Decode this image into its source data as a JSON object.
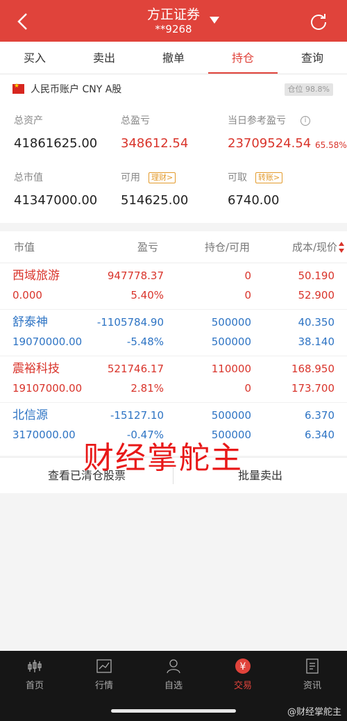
{
  "header": {
    "title": "方正证券",
    "subtitle": "**9268"
  },
  "tabs": [
    {
      "label": "买入"
    },
    {
      "label": "卖出"
    },
    {
      "label": "撤单"
    },
    {
      "label": "持仓",
      "active": true
    },
    {
      "label": "查询"
    }
  ],
  "account": {
    "label": "人民币账户 CNY A股",
    "position_ratio": "仓位 98.8%",
    "stats": {
      "total_assets_label": "总资产",
      "total_assets": "41861625.00",
      "total_pl_label": "总盈亏",
      "total_pl": "348612.54",
      "today_pl_label": "当日参考盈亏",
      "today_pl": "23709524.54",
      "today_pl_pct": "65.58%",
      "market_value_label": "总市值",
      "market_value": "41347000.00",
      "available_label": "可用",
      "available": "514625.00",
      "available_tag": "理财>",
      "withdrawable_label": "可取",
      "withdrawable": "6740.00",
      "withdrawable_tag": "转账>"
    }
  },
  "holdings": {
    "headers": {
      "market_value": "市值",
      "pl": "盈亏",
      "hold": "持仓/可用",
      "cost": "成本/现价"
    },
    "rows": [
      {
        "name": "西域旅游",
        "market_value": "0.000",
        "pl": "947778.37",
        "pl_pct": "5.40%",
        "hold": "0",
        "avail": "0",
        "cost": "50.190",
        "price": "52.900",
        "trend": "up"
      },
      {
        "name": "舒泰神",
        "market_value": "19070000.00",
        "pl": "-1105784.90",
        "pl_pct": "-5.48%",
        "hold": "500000",
        "avail": "500000",
        "cost": "40.350",
        "price": "38.140",
        "trend": "down"
      },
      {
        "name": "震裕科技",
        "market_value": "19107000.00",
        "pl": "521746.17",
        "pl_pct": "2.81%",
        "hold": "110000",
        "avail": "0",
        "cost": "168.950",
        "price": "173.700",
        "trend": "up"
      },
      {
        "name": "北信源",
        "market_value": "3170000.00",
        "pl": "-15127.10",
        "pl_pct": "-0.47%",
        "hold": "500000",
        "avail": "500000",
        "cost": "6.370",
        "price": "6.340",
        "trend": "down"
      }
    ]
  },
  "actions": {
    "cleared": "查看已清仓股票",
    "batch_sell": "批量卖出"
  },
  "watermark": "财经掌舵主",
  "bottom_nav": [
    {
      "label": "首页",
      "icon": "candlestick-icon"
    },
    {
      "label": "行情",
      "icon": "chart-icon"
    },
    {
      "label": "自选",
      "icon": "person-icon"
    },
    {
      "label": "交易",
      "icon": "yuan-icon",
      "active": true
    },
    {
      "label": "资讯",
      "icon": "news-icon"
    }
  ],
  "weibo_mark": "@财经掌舵主",
  "colors": {
    "brand": "#e0433b",
    "up": "#d9342b",
    "down": "#2e74c4",
    "tag": "#e39a2b"
  }
}
